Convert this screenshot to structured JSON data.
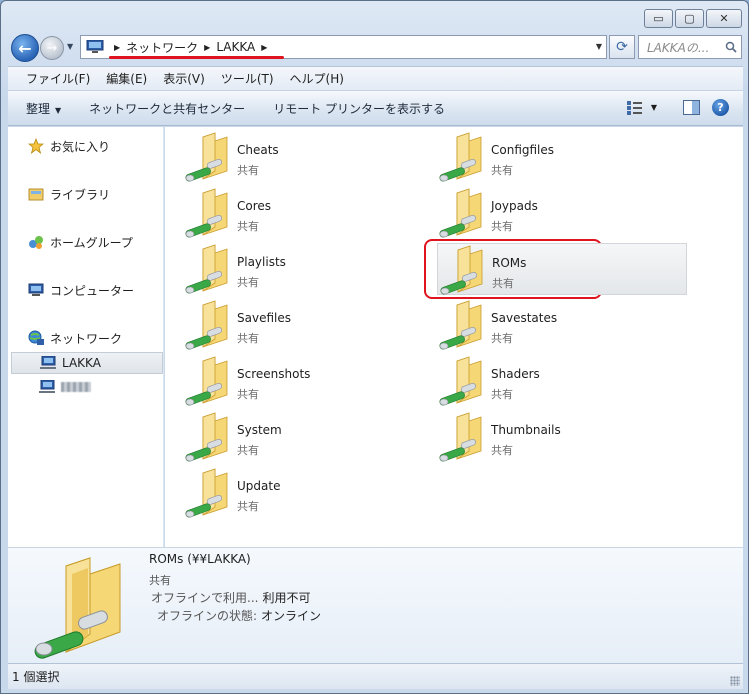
{
  "window": {
    "caption": {
      "minimize": "▭",
      "maximize": "▢",
      "close": "✕"
    }
  },
  "address": {
    "crumbs": [
      "ネットワーク",
      "LAKKA"
    ],
    "search_placeholder": "LAKKAの..."
  },
  "menu": [
    "ファイル(F)",
    "編集(E)",
    "表示(V)",
    "ツール(T)",
    "ヘルプ(H)"
  ],
  "commands": {
    "organize": "整理",
    "network_center": "ネットワークと共有センター",
    "remote_printers": "リモート プリンターを表示する"
  },
  "nav": {
    "favorites": "お気に入り",
    "libraries": "ライブラリ",
    "homegroup": "ホームグループ",
    "computer": "コンピューター",
    "network": "ネットワーク",
    "lakka": "LAKKA"
  },
  "folders": [
    {
      "name": "Cheats",
      "type": "共有"
    },
    {
      "name": "Configfiles",
      "type": "共有"
    },
    {
      "name": "Cores",
      "type": "共有"
    },
    {
      "name": "Joypads",
      "type": "共有"
    },
    {
      "name": "Playlists",
      "type": "共有"
    },
    {
      "name": "ROMs",
      "type": "共有"
    },
    {
      "name": "Savefiles",
      "type": "共有"
    },
    {
      "name": "Savestates",
      "type": "共有"
    },
    {
      "name": "Screenshots",
      "type": "共有"
    },
    {
      "name": "Shaders",
      "type": "共有"
    },
    {
      "name": "System",
      "type": "共有"
    },
    {
      "name": "Thumbnails",
      "type": "共有"
    },
    {
      "name": "Update",
      "type": "共有"
    }
  ],
  "details": {
    "title": "ROMs (¥¥LAKKA)",
    "type": "共有",
    "offline_label": "オフラインで利用...",
    "offline_value": "利用不可",
    "status_label": "オフラインの状態:",
    "status_value": "オンライン"
  },
  "status": {
    "selection": "1 個選択"
  },
  "colors": {
    "accent": "#e0141e",
    "folder": "#f2cf6b",
    "pipe": "#2e9d3a"
  }
}
